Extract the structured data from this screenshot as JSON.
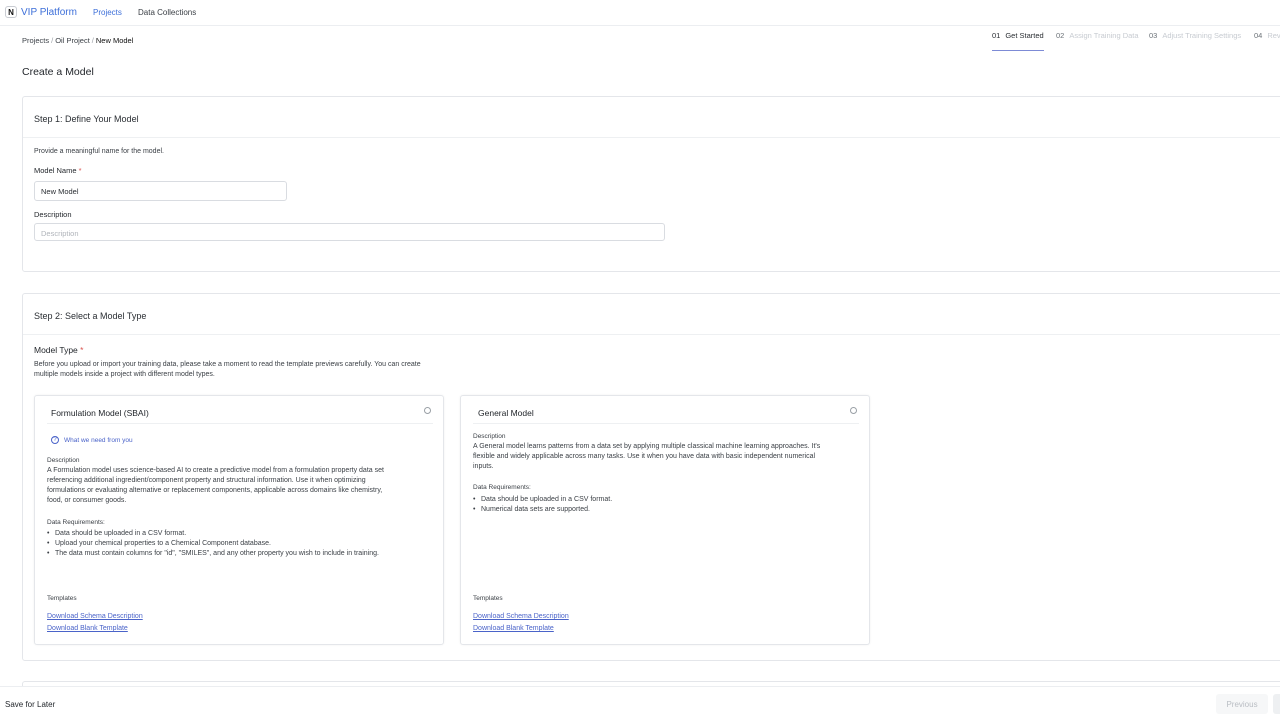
{
  "nav": {
    "logo_letter": "N",
    "app_name": "VIP Platform",
    "projects": "Projects",
    "data_collections": "Data Collections"
  },
  "breadcrumb": {
    "items": [
      "Projects",
      "Oil Project"
    ],
    "current": "New Model"
  },
  "stepper": [
    {
      "num": "01",
      "label": "Get Started",
      "state": "active"
    },
    {
      "num": "02",
      "label": "Assign Training Data",
      "state": "inactive"
    },
    {
      "num": "03",
      "label": "Adjust Training Settings",
      "state": "inactive"
    },
    {
      "num": "04",
      "label": "Rev",
      "state": "inactive"
    }
  ],
  "page_title": "Create a Model",
  "step1": {
    "title": "Step 1: Define Your Model",
    "hint": "Provide a meaningful name for the model.",
    "name_label": "Model Name",
    "required_mark": "*",
    "name_value": "New Model",
    "description_label": "Description",
    "description_placeholder": "Description"
  },
  "step2": {
    "title": "Step 2: Select a Model Type",
    "type_label": "Model Type",
    "required_mark": "*",
    "intro_line1": "Before you upload or import your training data, please take a moment to read the template previews carefully. You can create",
    "intro_line2": "multiple models inside a project with different model types.",
    "formulation": {
      "title": "Formulation Model (SBAI)",
      "help": "What we need from you",
      "desc_label": "Description",
      "desc_lines": [
        "A Formulation model uses science-based AI to create a predictive model from a formulation property data set",
        "referencing additional ingredient/component property and structural information. Use it when optimizing",
        "formulations or evaluating alternative or replacement components, applicable across domains like chemistry,",
        "food, or consumer goods."
      ],
      "req_label": "Data Requirements:",
      "requirements": [
        "Data should be uploaded in a CSV format.",
        "Upload your chemical properties to a Chemical Component database.",
        "The data must contain columns for \"id\", \"SMILES\", and any other property you wish to include in training."
      ],
      "templates_label": "Templates",
      "link_schema": "Download Schema Description",
      "link_blank": "Download Blank Template"
    },
    "general": {
      "title": "General Model",
      "desc_label": "Description",
      "desc_lines": [
        "A General model learns patterns from a data set by applying multiple classical machine learning approaches. It's",
        "flexible and widely applicable across many tasks. Use it when you have data with basic independent numerical",
        "inputs."
      ],
      "req_label": "Data Requirements:",
      "requirements": [
        "Data should be uploaded in a CSV format.",
        "Numerical data sets are supported."
      ],
      "templates_label": "Templates",
      "link_schema": "Download Schema Description",
      "link_blank": "Download Blank Template"
    }
  },
  "footer": {
    "save_later": "Save for Later",
    "previous": "Previous"
  },
  "colors": {
    "accent": "#3d6fd9",
    "link": "#4a63c9",
    "required": "#d9534f"
  }
}
